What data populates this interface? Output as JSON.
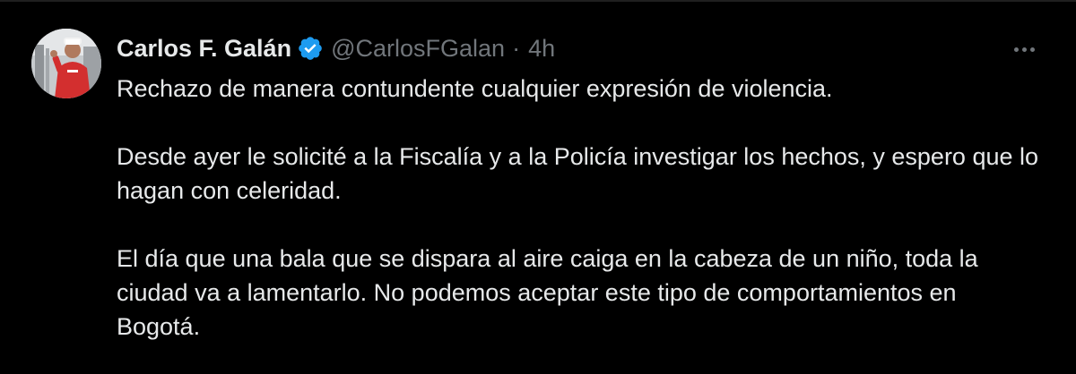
{
  "tweet": {
    "author": {
      "display_name": "Carlos F. Galán",
      "handle": "@CarlosFGalan",
      "verified": true
    },
    "separator": "·",
    "time": "4h",
    "paragraphs": [
      "Rechazo de manera contundente cualquier expresión de violencia.",
      "Desde ayer le solicité a la Fiscalía y a la Policía investigar los hechos, y espero que lo hagan con celeridad.",
      "El día que una bala que se dispara al aire caiga en la cabeza de un niño, toda la ciudad va a lamentarlo. No podemos aceptar este tipo de comportamientos en Bogotá."
    ]
  },
  "icons": {
    "verified": "verified-badge-icon",
    "more": "more-options-icon"
  },
  "colors": {
    "background": "#000000",
    "text_primary": "#e7e9ea",
    "text_secondary": "#71767b",
    "verified_blue": "#1d9bf0"
  }
}
